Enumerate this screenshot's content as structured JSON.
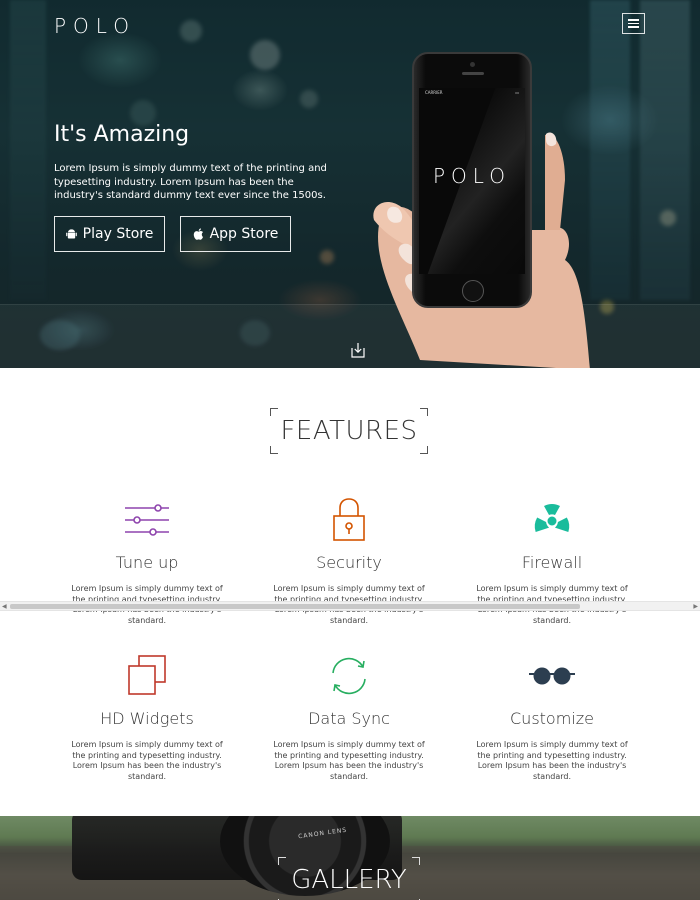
{
  "header": {
    "logo": "POLO",
    "menu_icon": "hamburger-menu-icon"
  },
  "hero": {
    "title": "It's Amazing",
    "text": "Lorem Ipsum is simply dummy text of the printing and typesetting industry. Lorem Ipsum has been the industry's standard dummy text ever since the 1500s.",
    "play_store_label": "Play Store",
    "play_store_icon": "android-icon",
    "app_store_label": "App Store",
    "app_store_icon": "apple-icon",
    "scroll_icon": "download-arrow-icon",
    "phone": {
      "carrier": "CARRIER",
      "screen_logo": "POLO"
    }
  },
  "features": {
    "title": "FEATURES",
    "items": [
      {
        "title": "Tune up",
        "icon": "sliders-icon",
        "color": "#8e44ad",
        "desc": "Lorem Ipsum is simply dummy text of the printing and typesetting industry. Lorem Ipsum has been the industry's standard."
      },
      {
        "title": "Security",
        "icon": "lock-icon",
        "color": "#d35400",
        "desc": "Lorem Ipsum is simply dummy text of the printing and typesetting industry. Lorem Ipsum has been the industry's standard."
      },
      {
        "title": "Firewall",
        "icon": "radiation-icon",
        "color": "#1abc9c",
        "desc": "Lorem Ipsum is simply dummy text of the printing and typesetting industry. Lorem Ipsum has been the industry's standard."
      },
      {
        "title": "HD Widgets",
        "icon": "layers-icon",
        "color": "#c0392b",
        "desc": "Lorem Ipsum is simply dummy text of the printing and typesetting industry. Lorem Ipsum has been the industry's standard."
      },
      {
        "title": "Data Sync",
        "icon": "sync-icon",
        "color": "#27ae60",
        "desc": "Lorem Ipsum is simply dummy text of the printing and typesetting industry. Lorem Ipsum has been the industry's standard."
      },
      {
        "title": "Customize",
        "icon": "sunglasses-icon",
        "color": "#2c3e50",
        "desc": "Lorem Ipsum is simply dummy text of the printing and typesetting industry. Lorem Ipsum has been the industry's standard."
      }
    ]
  },
  "gallery": {
    "title": "GALLERY",
    "lens_text": "CANON LENS"
  }
}
